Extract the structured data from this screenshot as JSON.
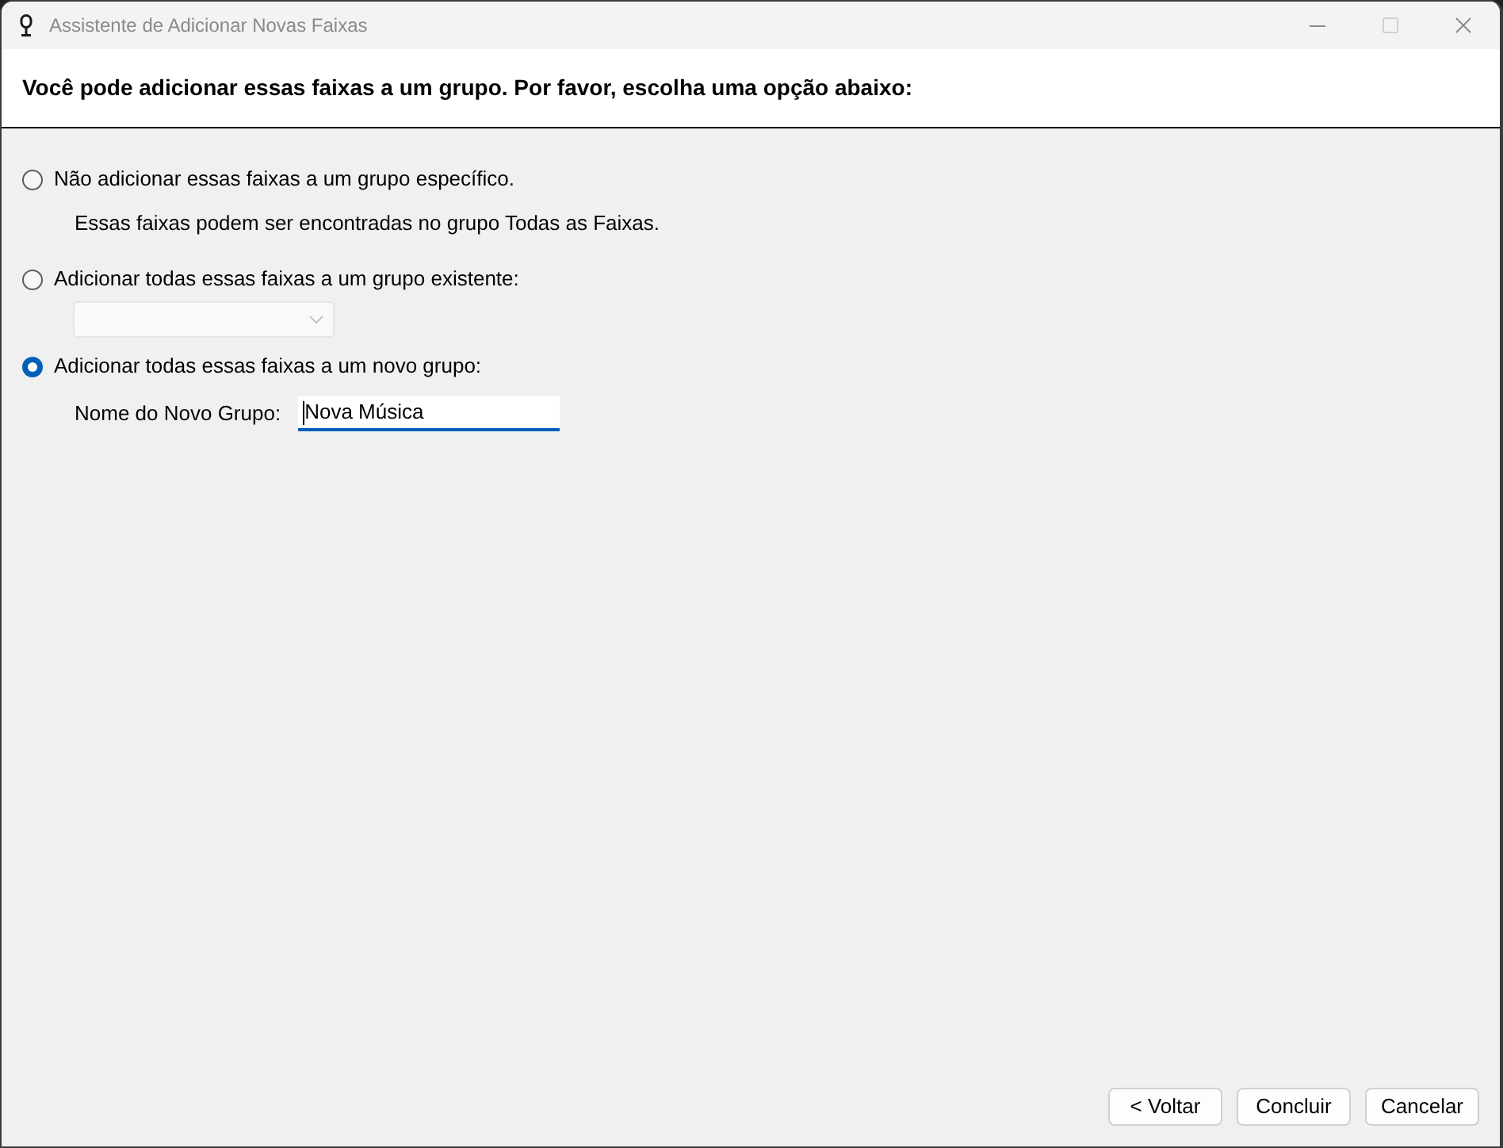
{
  "window": {
    "title": "Assistente de Adicionar Novas Faixas",
    "controls": [
      {
        "kind": "minimize",
        "disabled": false
      },
      {
        "kind": "maximize",
        "disabled": true
      },
      {
        "kind": "close",
        "disabled": false
      }
    ]
  },
  "header": {
    "text": "Você pode adicionar essas faixas a um grupo. Por favor, escolha uma opção abaixo:"
  },
  "options": [
    {
      "kind": "plain",
      "label": "Não adicionar essas faixas a um grupo específico.",
      "selected": false,
      "note": "Essas faixas podem ser encontradas no grupo Todas as Faixas."
    },
    {
      "kind": "dropdown",
      "label": "Adicionar todas essas faixas a um grupo existente:",
      "selected": false,
      "dropdown": {
        "disabled": true
      }
    },
    {
      "kind": "name",
      "label": "Adicionar todas essas faixas a um novo grupo:",
      "selected": true,
      "field": {
        "label": "Nome do Novo Grupo:",
        "value": "Nova Música",
        "focused": true
      }
    }
  ],
  "buttons": [
    {
      "label": "< Voltar"
    },
    {
      "label": "Concluir"
    },
    {
      "label": "Cancelar"
    }
  ]
}
